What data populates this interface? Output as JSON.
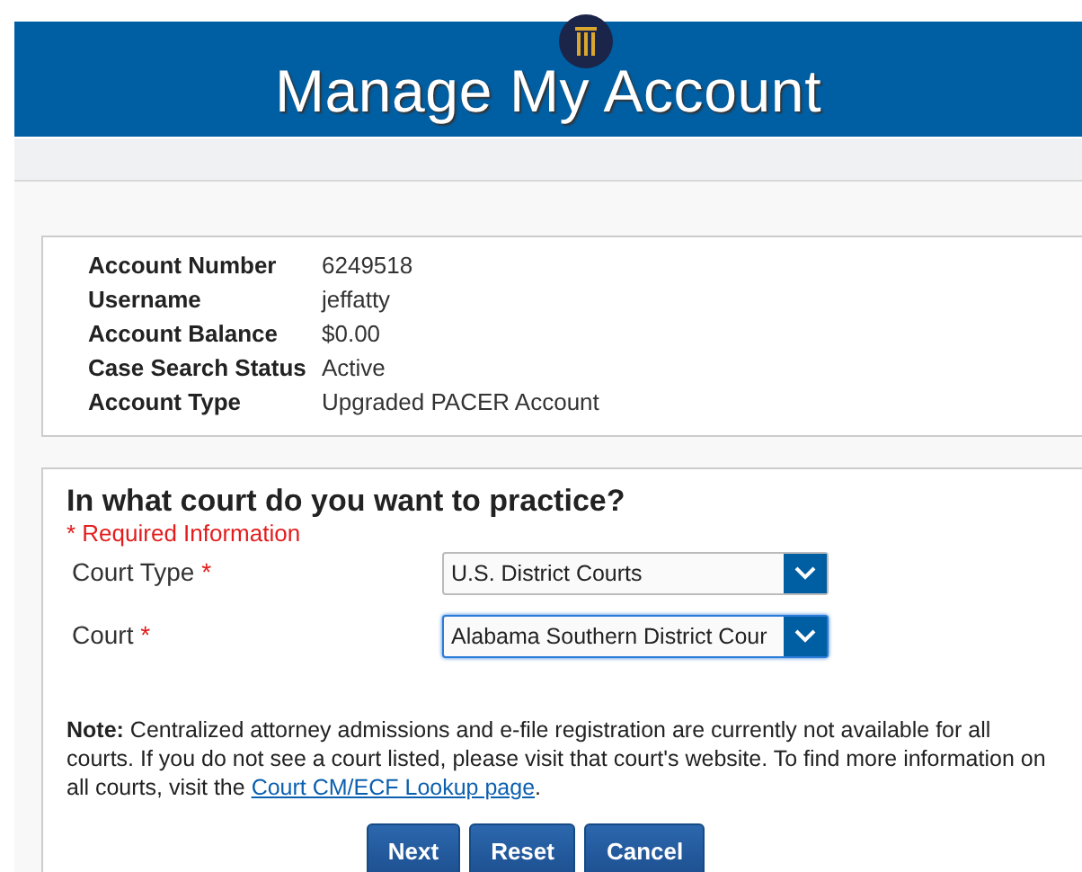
{
  "header": {
    "title": "Manage My Account"
  },
  "account": [
    {
      "label": "Account Number",
      "value": "6249518"
    },
    {
      "label": "Username",
      "value": "jeffatty"
    },
    {
      "label": "Account Balance",
      "value": "$0.00"
    },
    {
      "label": "Case Search Status",
      "value": "Active"
    },
    {
      "label": "Account Type",
      "value": "Upgraded PACER Account"
    }
  ],
  "form": {
    "heading": "In what court do you want to practice?",
    "required_note": "* Required Information",
    "fields": [
      {
        "label": "Court Type",
        "required_mark": "*",
        "value": "U.S. District Courts",
        "focused": false
      },
      {
        "label": "Court",
        "required_mark": "*",
        "value": "Alabama Southern District Cour",
        "focused": true
      }
    ],
    "note": {
      "text": "**Note:** Centralized attorney admissions and e-file registration are currently not available for all courts. If you do not see a court listed, please visit that court's website. To find more information on all courts, visit the ",
      "link": "Court CM/ECF Lookup page",
      "after": "."
    },
    "buttons": [
      "Next",
      "Reset",
      "Cancel"
    ]
  }
}
